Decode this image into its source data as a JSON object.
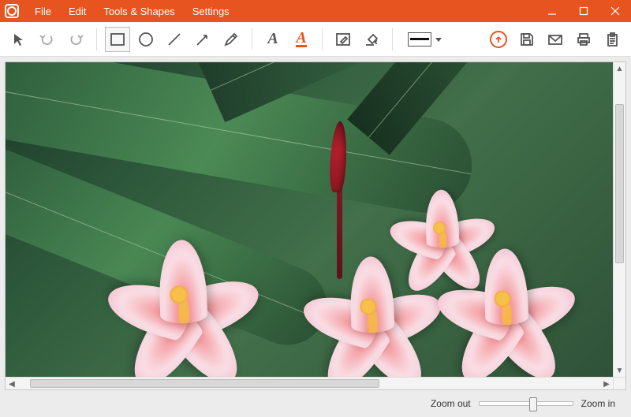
{
  "menu": {
    "file": "File",
    "edit": "Edit",
    "tools_shapes": "Tools & Shapes",
    "settings": "Settings"
  },
  "toolbar": {
    "pointer": "pointer",
    "undo": "undo",
    "redo": "redo",
    "rect": "rectangle",
    "ellipse": "ellipse",
    "line": "line",
    "arrow": "arrow",
    "pencil": "pencil",
    "text": "A",
    "text_highlight": "A",
    "edit_pen": "edit",
    "fill": "fill",
    "line_style": "line-style",
    "upload": "upload",
    "save": "save",
    "email": "email",
    "print": "print",
    "clipboard": "clipboard"
  },
  "status": {
    "zoom_out": "Zoom out",
    "zoom_in": "Zoom in"
  },
  "colors": {
    "accent": "#e8541f",
    "icon": "#555555"
  }
}
